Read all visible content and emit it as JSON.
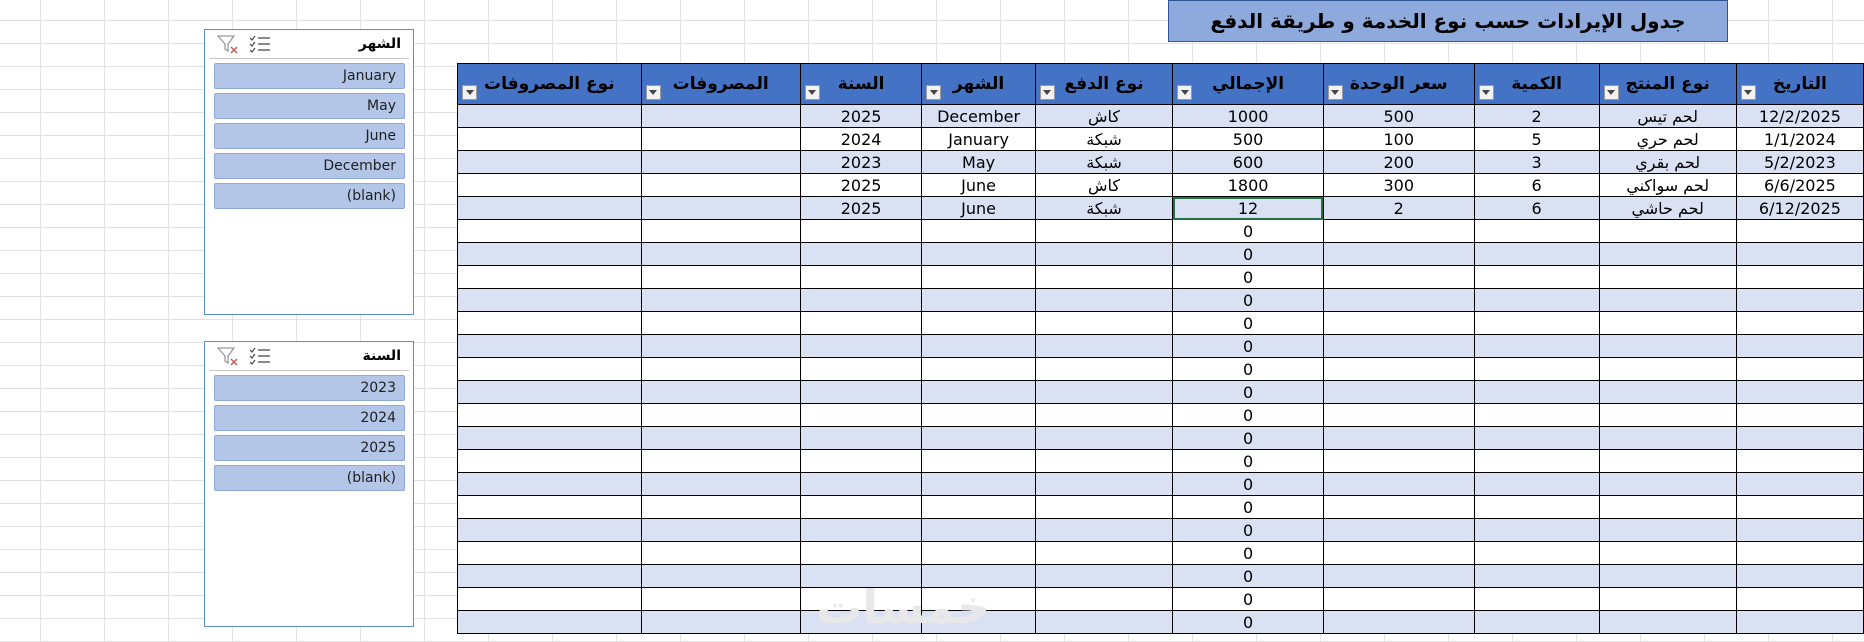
{
  "title": "جدول الإيرادات حسب نوع الخدمة و طريقة الدفع",
  "table": {
    "headers": [
      "نوع المصروفات",
      "المصروفات",
      "السنة",
      "الشهر",
      "نوع الدفع",
      "الإجمالي",
      "سعر الوحدة",
      "الكمية",
      "نوع المنتج",
      "التاريخ"
    ],
    "rows": [
      [
        "",
        "",
        "2025",
        "December",
        "كاش",
        "1000",
        "500",
        "2",
        "لحم تيس",
        "12/2/2025"
      ],
      [
        "",
        "",
        "2024",
        "January",
        "شبكة",
        "500",
        "100",
        "5",
        "لحم حري",
        "1/1/2024"
      ],
      [
        "",
        "",
        "2023",
        "May",
        "شبكة",
        "600",
        "200",
        "3",
        "لحم بقري",
        "5/2/2023"
      ],
      [
        "",
        "",
        "2025",
        "June",
        "كاش",
        "1800",
        "300",
        "6",
        "لحم سواكني",
        "6/6/2025"
      ],
      [
        "",
        "",
        "2025",
        "June",
        "شبكة",
        "12",
        "2",
        "6",
        "لحم حاشي",
        "6/12/2025"
      ]
    ],
    "empty_total": "0",
    "empty_rows": 18
  },
  "slicer_month": {
    "title": "الشهر",
    "items": [
      "January",
      "May",
      "June",
      "December",
      "(blank)"
    ]
  },
  "slicer_year": {
    "title": "السنة",
    "items": [
      "2023",
      "2024",
      "2025",
      "(blank)"
    ]
  },
  "watermark": "خمسات",
  "colors": {
    "header_fill": "#4472c4",
    "title_fill": "#8ea9db",
    "band_fill": "#d9e1f2",
    "slicer_item": "#b4c6e7",
    "selection": "#217346"
  }
}
